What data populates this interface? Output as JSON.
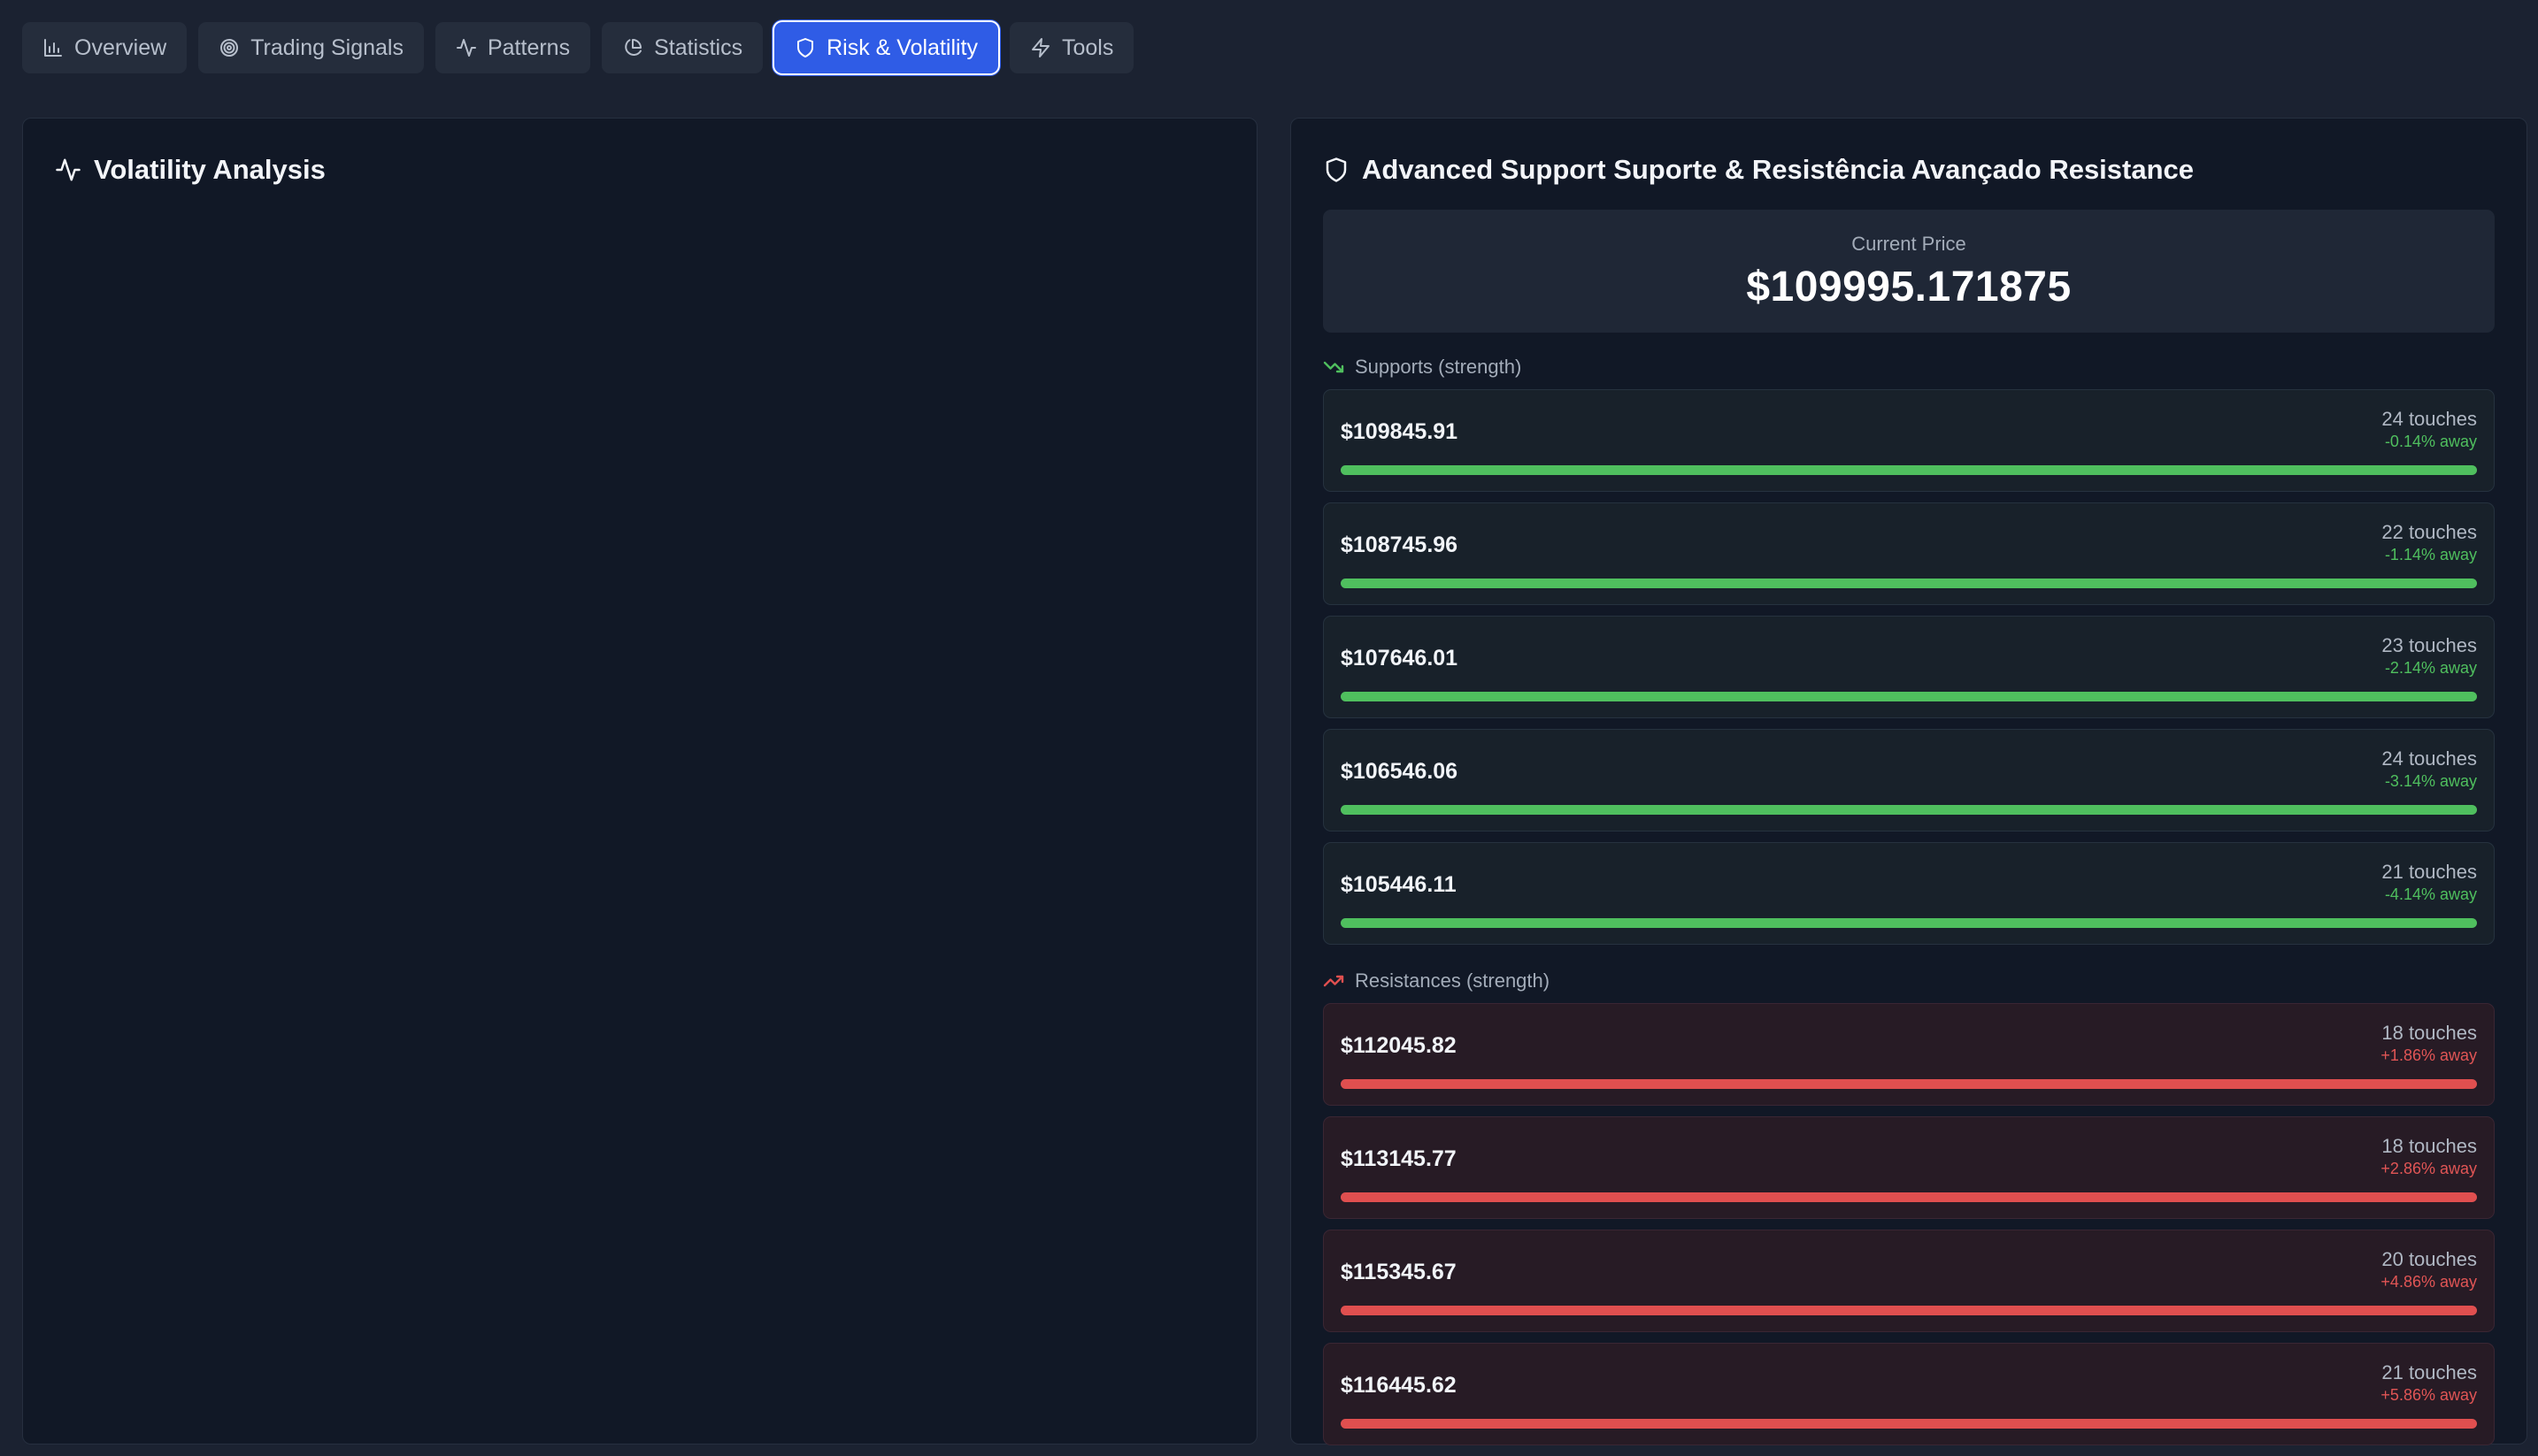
{
  "tabs": [
    {
      "label": "Overview",
      "icon": "bar-chart-icon",
      "active": false
    },
    {
      "label": "Trading Signals",
      "icon": "target-icon",
      "active": false
    },
    {
      "label": "Patterns",
      "icon": "activity-icon",
      "active": false
    },
    {
      "label": "Statistics",
      "icon": "pie-chart-icon",
      "active": false
    },
    {
      "label": "Risk & Volatility",
      "icon": "shield-icon",
      "active": true
    },
    {
      "label": "Tools",
      "icon": "zap-icon",
      "active": false
    }
  ],
  "volatility": {
    "title": "Volatility Analysis",
    "icon": "activity-icon"
  },
  "support_resistance": {
    "title": "Advanced Support Suporte & Resistência Avançado Resistance",
    "icon": "shield-icon",
    "current_price_label": "Current Price",
    "current_price": "$109995.171875",
    "supports_label": "Supports (strength)",
    "resistances_label": "Resistances (strength)",
    "colors": {
      "support": "#4fbf5e",
      "resistance": "#e04f4f",
      "accent": "#2f5ce6"
    },
    "supports": [
      {
        "price": "$109845.91",
        "touches": "24 touches",
        "away": "-0.14% away",
        "strength": 1.0
      },
      {
        "price": "$108745.96",
        "touches": "22 touches",
        "away": "-1.14% away",
        "strength": 1.0
      },
      {
        "price": "$107646.01",
        "touches": "23 touches",
        "away": "-2.14% away",
        "strength": 1.0
      },
      {
        "price": "$106546.06",
        "touches": "24 touches",
        "away": "-3.14% away",
        "strength": 1.0
      },
      {
        "price": "$105446.11",
        "touches": "21 touches",
        "away": "-4.14% away",
        "strength": 1.0
      }
    ],
    "resistances": [
      {
        "price": "$112045.82",
        "touches": "18 touches",
        "away": "+1.86% away",
        "strength": 1.0
      },
      {
        "price": "$113145.77",
        "touches": "18 touches",
        "away": "+2.86% away",
        "strength": 1.0
      },
      {
        "price": "$115345.67",
        "touches": "20 touches",
        "away": "+4.86% away",
        "strength": 1.0
      },
      {
        "price": "$116445.62",
        "touches": "21 touches",
        "away": "+5.86% away",
        "strength": 1.0
      }
    ]
  }
}
